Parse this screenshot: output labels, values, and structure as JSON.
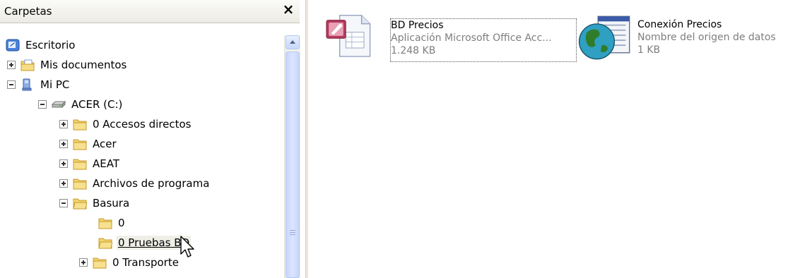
{
  "folders_pane": {
    "title": "Carpetas",
    "close_label": "×"
  },
  "tree": [
    {
      "label": "Escritorio",
      "icon": "desktop-icon",
      "expander": "none"
    },
    {
      "label": "Mis documentos",
      "icon": "documents-folder-icon",
      "expander": "plus"
    },
    {
      "label": "Mi PC",
      "icon": "computer-icon",
      "expander": "minus"
    },
    {
      "label": "ACER (C:)",
      "icon": "drive-icon",
      "expander": "minus"
    },
    {
      "label": "0 Accesos directos",
      "icon": "folder-icon",
      "expander": "plus"
    },
    {
      "label": "Acer",
      "icon": "folder-icon",
      "expander": "plus"
    },
    {
      "label": "AEAT",
      "icon": "folder-icon",
      "expander": "plus"
    },
    {
      "label": "Archivos de programa",
      "icon": "folder-icon",
      "expander": "plus"
    },
    {
      "label": "Basura",
      "icon": "folder-open-icon",
      "expander": "minus"
    },
    {
      "label": "0",
      "icon": "folder-icon",
      "expander": "none"
    },
    {
      "label": "0 Pruebas BD",
      "icon": "folder-open-icon",
      "expander": "none",
      "hover": true
    },
    {
      "label": "0 Transporte",
      "icon": "folder-icon",
      "expander": "plus"
    }
  ],
  "files": [
    {
      "name": "BD Precios",
      "type": "Aplicación Microsoft Office Acc...",
      "size": "1.248 KB",
      "icon": "access-database-icon",
      "selected": true
    },
    {
      "name": "Conexión Precios",
      "type": "Nombre del origen de datos",
      "size": "1 KB",
      "icon": "odbc-dsn-icon",
      "selected": false
    }
  ],
  "colors": {
    "folder": "#f3d36b",
    "hover_bg": "#efefe7",
    "secondary_text": "#7e7e7e",
    "scrollbar": "#c8d6fb"
  }
}
